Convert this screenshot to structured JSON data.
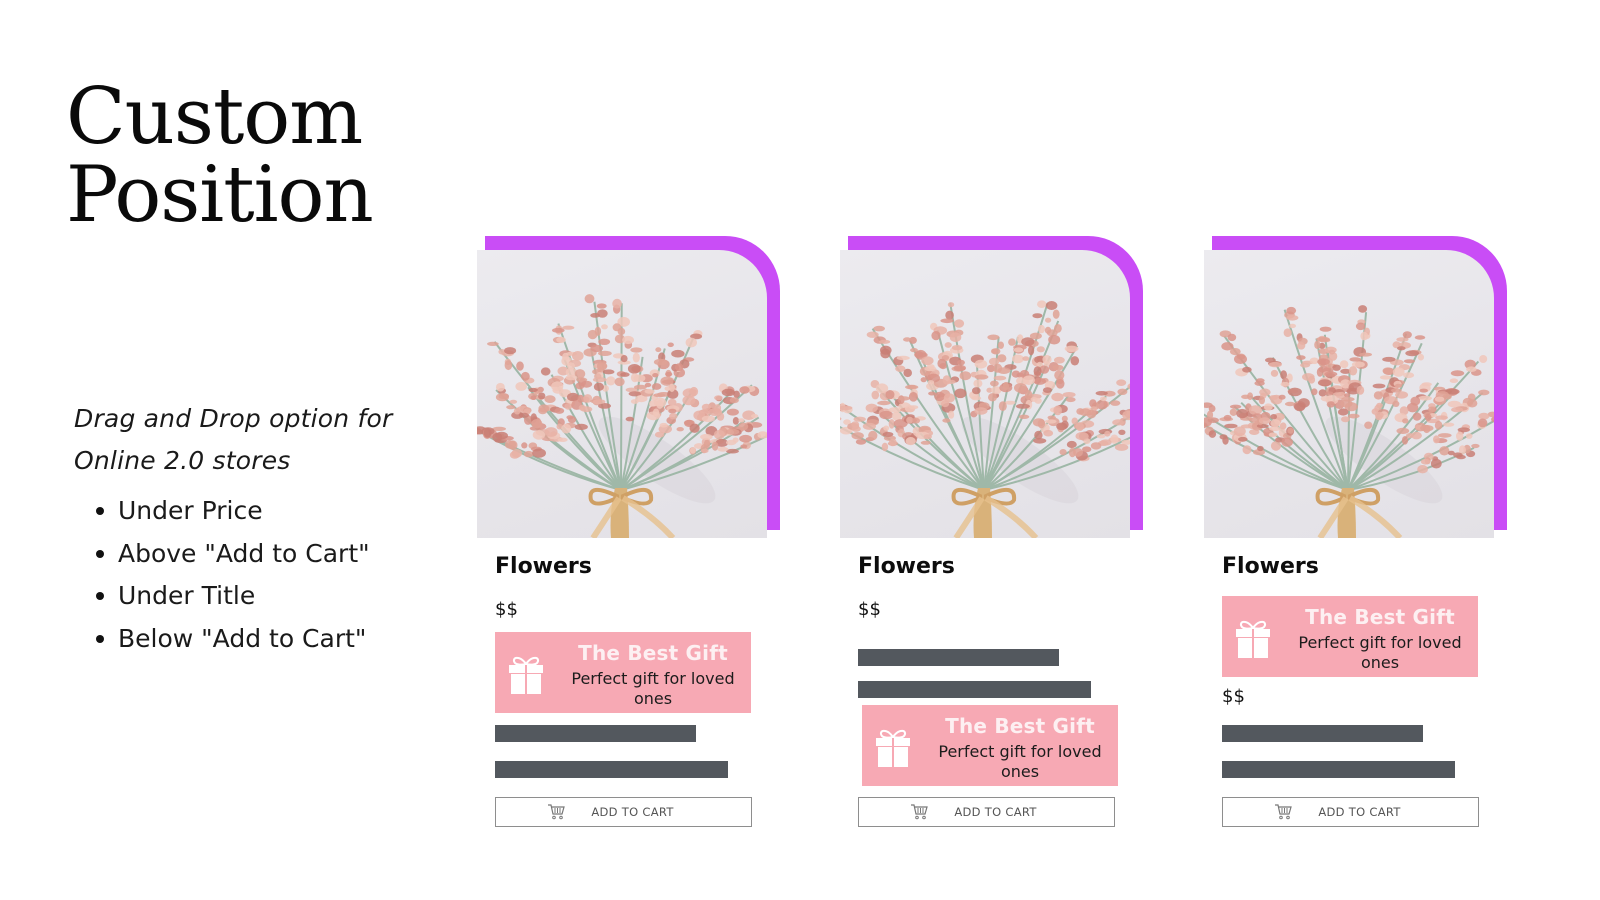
{
  "title": {
    "line1": "Custom",
    "line2": "Position"
  },
  "description": {
    "subtitle": "Drag and Drop option for Online 2.0 stores",
    "bullets": [
      "Under Price",
      "Above \"Add to Cart\"",
      "Under Title",
      "Below \"Add to Cart\""
    ]
  },
  "colors": {
    "frame_accent": "#c94df6",
    "gift_banner": "#f7a9b4",
    "placeholder_bar": "#53585e"
  },
  "cards": [
    {
      "product_name": "Flowers",
      "price": "$$",
      "gift_position": "under-price",
      "gift": {
        "icon": "gift-icon",
        "title": "The Best Gift",
        "subtitle": "Perfect gift for loved ones"
      },
      "cart_button": {
        "icon": "cart-icon",
        "label": "ADD TO CART"
      }
    },
    {
      "product_name": "Flowers",
      "price": "$$",
      "gift_position": "above-add-to-cart",
      "gift": {
        "icon": "gift-icon",
        "title": "The Best Gift",
        "subtitle": "Perfect gift for loved ones"
      },
      "cart_button": {
        "icon": "cart-icon",
        "label": "ADD TO CART"
      }
    },
    {
      "product_name": "Flowers",
      "price": "$$",
      "gift_position": "under-title",
      "gift": {
        "icon": "gift-icon",
        "title": "The Best Gift",
        "subtitle": "Perfect gift for loved ones"
      },
      "cart_button": {
        "icon": "cart-icon",
        "label": "ADD TO CART"
      }
    }
  ]
}
